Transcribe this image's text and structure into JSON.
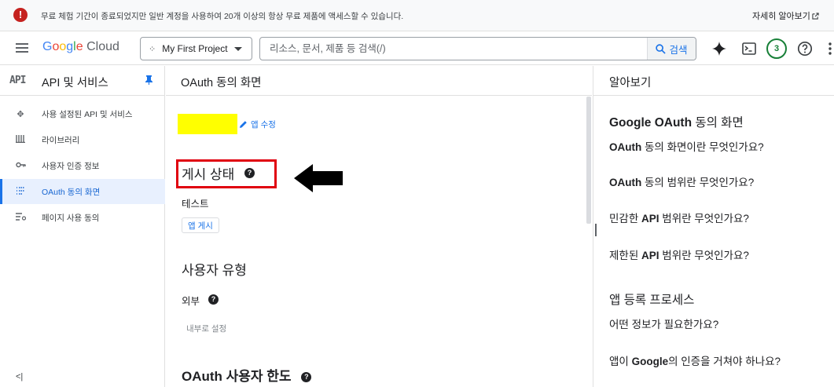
{
  "banner": {
    "icon": "error-icon",
    "message": "무료 체험 기간이 종료되었지만 일반 계정을 사용하여 20개 이상의 항상 무료 제품에 액세스할 수 있습니다.",
    "link": "자세히 알아보기"
  },
  "header": {
    "logo_google": [
      "G",
      "o",
      "o",
      "g",
      "l",
      "e"
    ],
    "logo_cloud": "Cloud",
    "project": "My First Project",
    "search_placeholder": "리소스, 문서, 제품 등 검색(/)",
    "search_button": "검색",
    "notifications_count": "3"
  },
  "sidebar": {
    "api_badge": "API",
    "title": "API 및 서비스",
    "items": [
      {
        "label": "사용 설정된 API 및 서비스",
        "icon": "diamond-arrows-icon"
      },
      {
        "label": "라이브러리",
        "icon": "library-icon"
      },
      {
        "label": "사용자 인증 정보",
        "icon": "key-icon"
      },
      {
        "label": "OAuth 동의 화면",
        "icon": "consent-icon",
        "active": true
      },
      {
        "label": "페이지 사용 동의",
        "icon": "settings-list-icon"
      }
    ],
    "collapse": "<|"
  },
  "main": {
    "title": "OAuth 동의 화면",
    "edit_app": "앱 수정",
    "publish_status_title": "게시 상태",
    "status_value": "테스트",
    "publish_button": "앱 게시",
    "user_type_title": "사용자 유형",
    "user_type_value": "외부",
    "make_internal": "내부로 설정",
    "quota_title": "OAuth 사용자 한도"
  },
  "right_panel": {
    "title": "알아보기",
    "section1": {
      "title_bold": "Google OAuth",
      "title_rest": " 동의 화면",
      "links": [
        {
          "bold": "OAuth",
          "rest": " 동의 화면이란 무엇인가요?"
        },
        {
          "bold": "OAuth",
          "rest": " 동의 범위란 무엇인가요?"
        },
        {
          "pre": "민감한 ",
          "bold": "API",
          "rest": " 범위란 무엇인가요?"
        },
        {
          "pre": "제한된 ",
          "bold": "API",
          "rest": " 범위란 무엇인가요?"
        }
      ]
    },
    "section2": {
      "title": "앱 등록 프로세스",
      "links": [
        {
          "pre": "어떤 정보가 필요한가요?",
          "bold": "",
          "rest": ""
        },
        {
          "pre": "앱이 ",
          "bold": "Google",
          "rest": "의 인증을 거쳐야 하나요?"
        }
      ]
    }
  },
  "colors": {
    "accent": "#1a73e8",
    "highlight_box": "#e0000f",
    "redacted_app_name": "#ffff00",
    "error": "#c5221f",
    "badge_green": "#188038"
  }
}
